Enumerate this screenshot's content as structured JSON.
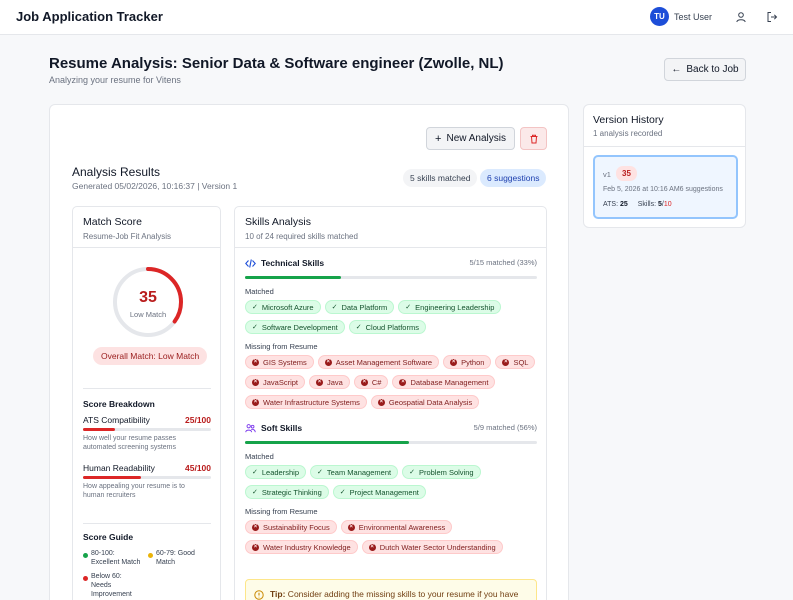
{
  "app": {
    "title": "Job Application Tracker"
  },
  "user": {
    "initials": "TU",
    "name": "Test User"
  },
  "page": {
    "title": "Resume Analysis: Senior Data & Software engineer (Zwolle, NL)",
    "subtitle": "Analyzing your resume for Vitens",
    "back_label": "Back to Job"
  },
  "toolbar": {
    "new_analysis_label": "New Analysis"
  },
  "results": {
    "title": "Analysis Results",
    "generated": "Generated 05/02/2026, 10:16:37 | Version 1",
    "skills_matched_pill": "5 skills matched",
    "suggestions_pill": "6 suggestions"
  },
  "match_score": {
    "title": "Match Score",
    "subtitle": "Resume-Job Fit Analysis",
    "value": "35",
    "value_num": 35,
    "value_label": "Low Match",
    "overall": "Overall Match: Low Match",
    "breakdown_title": "Score Breakdown",
    "breakdown": [
      {
        "label": "ATS Compatibility",
        "value": "25/100",
        "fraction": 0.25,
        "desc_1": "How well your resume passes",
        "desc_2": "automated screening systems"
      },
      {
        "label": "Human Readability",
        "value": "45/100",
        "fraction": 0.45,
        "desc_1": "How appealing your resume is to",
        "desc_2": "human recruiters"
      }
    ],
    "guide_title": "Score Guide",
    "guide": [
      {
        "line1": "80-100:",
        "line2": "Excellent Match",
        "color": "#16a34a"
      },
      {
        "line1": "60-79: Good",
        "line2": "Match",
        "color": "#eab308"
      },
      {
        "line1": "Below 60:",
        "line2": "Needs",
        "line3": "Improvement",
        "color": "#dc2626"
      }
    ]
  },
  "skills": {
    "title": "Skills Analysis",
    "subtitle": "10 of 24 required skills matched",
    "matched_label": "Matched",
    "missing_label": "Missing from Resume",
    "technical": {
      "name": "Technical Skills",
      "count": "5/15 matched (33%)",
      "fraction": 0.33,
      "matched": [
        "Microsoft Azure",
        "Data Platform",
        "Engineering Leadership",
        "Software Development",
        "Cloud Platforms"
      ],
      "missing": [
        "GIS Systems",
        "Asset Management Software",
        "Python",
        "SQL",
        "JavaScript",
        "Java",
        "C#",
        "Database Management",
        "Water Infrastructure Systems",
        "Geospatial Data Analysis"
      ]
    },
    "soft": {
      "name": "Soft Skills",
      "count": "5/9 matched (56%)",
      "fraction": 0.56,
      "matched": [
        "Leadership",
        "Team Management",
        "Problem Solving",
        "Strategic Thinking",
        "Project Management"
      ],
      "missing": [
        "Sustainability Focus",
        "Environmental Awareness",
        "Water Industry Knowledge",
        "Dutch Water Sector Understanding"
      ]
    },
    "tip_label": "Tip:",
    "tip_text": " Consider adding the missing skills to your resume if you have experience with them. Use the exact wording from the job description."
  },
  "history": {
    "title": "Version History",
    "subtitle": "1 analysis recorded",
    "item": {
      "version": "v1",
      "score": "35",
      "date": "Feb 5, 2026 at 10:16 AM",
      "suggestions": "6 suggestions",
      "ats_label": "ATS:",
      "ats_value": "25",
      "skills_label": "Skills:",
      "skills_matched": "5",
      "skills_total": "10"
    }
  },
  "colors": {
    "accent": "#1d4ed8",
    "danger": "#dc2626",
    "success": "#16a34a"
  }
}
